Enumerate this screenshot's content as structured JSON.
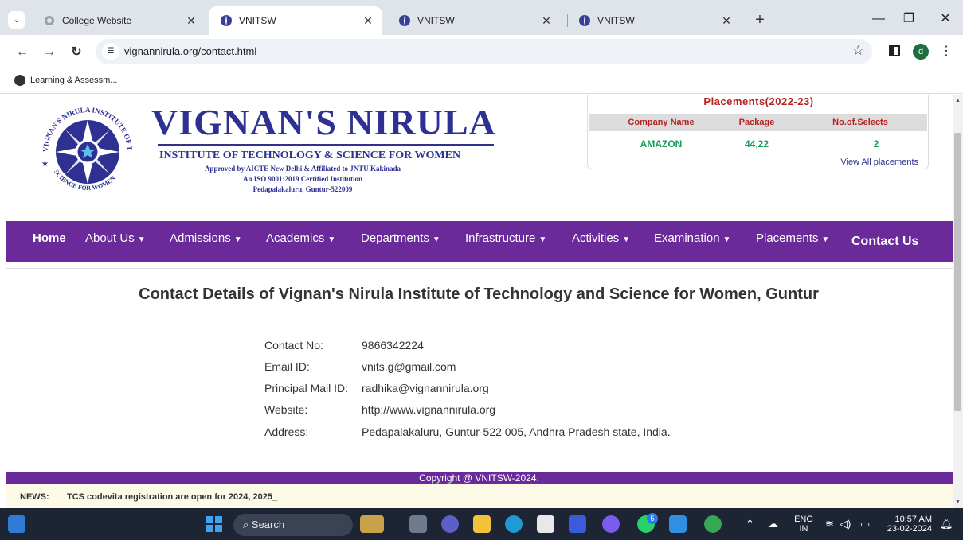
{
  "browser": {
    "tabs": [
      {
        "title": "College Website",
        "active": false
      },
      {
        "title": "VNITSW",
        "active": true
      },
      {
        "title": "VNITSW",
        "active": false
      },
      {
        "title": "VNITSW",
        "active": false
      }
    ],
    "url": "vignannirula.org/contact.html",
    "profile_initial": "d",
    "bookmarks": [
      {
        "label": "Learning & Assessm..."
      }
    ]
  },
  "header": {
    "logo_text_top": "VIGNAN'S NIRULA INSTITUTE OF TECHNOLOGY AND",
    "logo_text_bottom": "SCIENCE FOR WOMEN",
    "brand_name": "VIGNAN'S NIRULA",
    "brand_subtitle": "INSTITUTE OF TECHNOLOGY & SCIENCE FOR WOMEN",
    "approval": "Approved by AICTE New Delhi & Affiliated to JNTU Kakinada",
    "iso": "An ISO 9001:2019 Certified Institution",
    "location": "Pedapalakaluru, Guntur-522009"
  },
  "placements": {
    "title": "Placements(2022-23)",
    "columns": [
      "Company Name",
      "Package",
      "No.of.Selects"
    ],
    "rows": [
      [
        "AMAZON",
        "44,22",
        "2"
      ]
    ],
    "view_all": "View All placements"
  },
  "nav": {
    "items": [
      {
        "label": "Home",
        "dropdown": false
      },
      {
        "label": "About Us",
        "dropdown": true
      },
      {
        "label": "Admissions",
        "dropdown": true
      },
      {
        "label": "Academics",
        "dropdown": true
      },
      {
        "label": "Departments",
        "dropdown": true
      },
      {
        "label": "Infrastructure",
        "dropdown": true
      },
      {
        "label": "Activities",
        "dropdown": true
      },
      {
        "label": "Examination",
        "dropdown": true
      },
      {
        "label": "Placements",
        "dropdown": true
      },
      {
        "label": "Contact Us",
        "dropdown": false
      }
    ],
    "caret": "▼",
    "bg_color": "#6a2a9a"
  },
  "main": {
    "title": "Contact Details of Vignan's Nirula Institute of Technology and Science for Women, Guntur",
    "contacts": [
      {
        "label": "Contact No:",
        "value": "9866342224"
      },
      {
        "label": "Email ID:",
        "value": "vnits.g@gmail.com"
      },
      {
        "label": "Principal Mail ID:",
        "value": "radhika@vignannirula.org"
      },
      {
        "label": "Website:",
        "value": "http://www.vignannirula.org"
      },
      {
        "label": "Address:",
        "value": "Pedapalakaluru, Guntur-522 005, Andhra Pradesh state, India."
      }
    ]
  },
  "footer": {
    "copyright": "Copyright @ VNITSW-2024.",
    "news_label": "NEWS:",
    "news_text": "TCS codevita registration are open for 2024, 2025_"
  },
  "taskbar": {
    "search_placeholder": "Search",
    "language": "ENG",
    "region": "IN",
    "time": "10:57 AM",
    "date": "23-02-2024",
    "chat_badge": "5"
  }
}
